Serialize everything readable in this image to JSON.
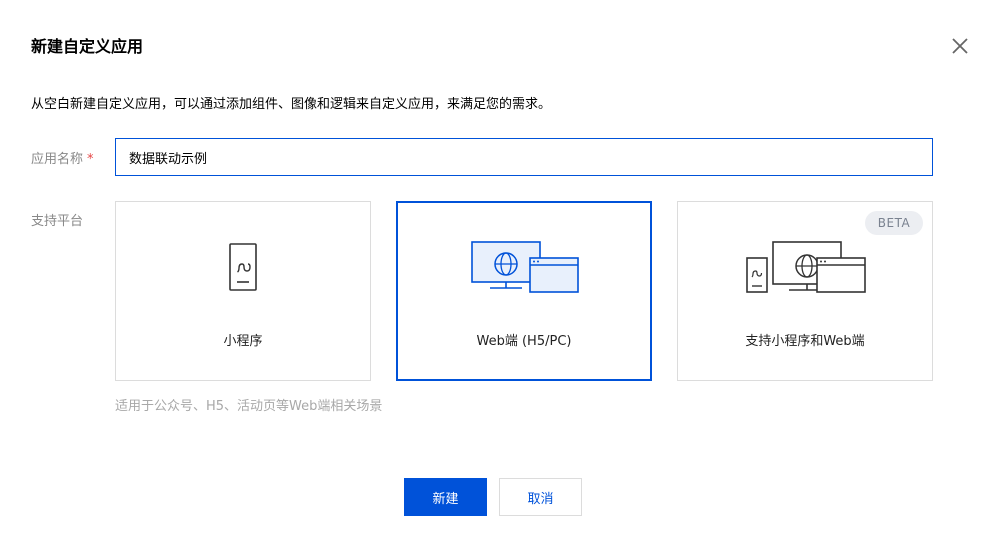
{
  "dialog": {
    "title": "新建自定义应用",
    "description": "从空白新建自定义应用，可以通过添加组件、图像和逻辑来自定义应用，来满足您的需求。"
  },
  "form": {
    "name_label": "应用名称",
    "required_mark": "*",
    "name_value": "数据联动示例",
    "platform_label": "支持平台",
    "platform_hint": "适用于公众号、H5、活动页等Web端相关场景"
  },
  "platforms": [
    {
      "label": "小程序",
      "icon": "mobile-miniprogram-icon",
      "selected": false
    },
    {
      "label": "Web端 (H5/PC)",
      "icon": "web-browser-monitor-icon",
      "selected": true
    },
    {
      "label": "支持小程序和Web端",
      "icon": "mobile-web-combined-icon",
      "selected": false,
      "badge": "BETA"
    }
  ],
  "buttons": {
    "create": "新建",
    "cancel": "取消"
  },
  "colors": {
    "accent": "#0052d9",
    "required": "#e54545",
    "border": "#dcdcdc",
    "muted": "#a8a8a8"
  }
}
